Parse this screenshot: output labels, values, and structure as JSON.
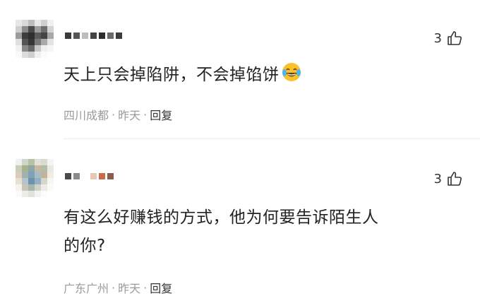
{
  "comments": [
    {
      "likes": "3",
      "text": "天上只会掉陷阱，不会掉馅饼",
      "emoji": "laughing-tears-emoji",
      "location": "四川成都",
      "time": "昨天",
      "reply": "回复",
      "dot": "·"
    },
    {
      "likes": "3",
      "text_line1": "有这么好赚钱的方式，他为何要告诉陌生人",
      "text_line2": "的你?",
      "location": "广东广州",
      "time": "昨天",
      "reply": "回复",
      "dot": "·"
    }
  ]
}
